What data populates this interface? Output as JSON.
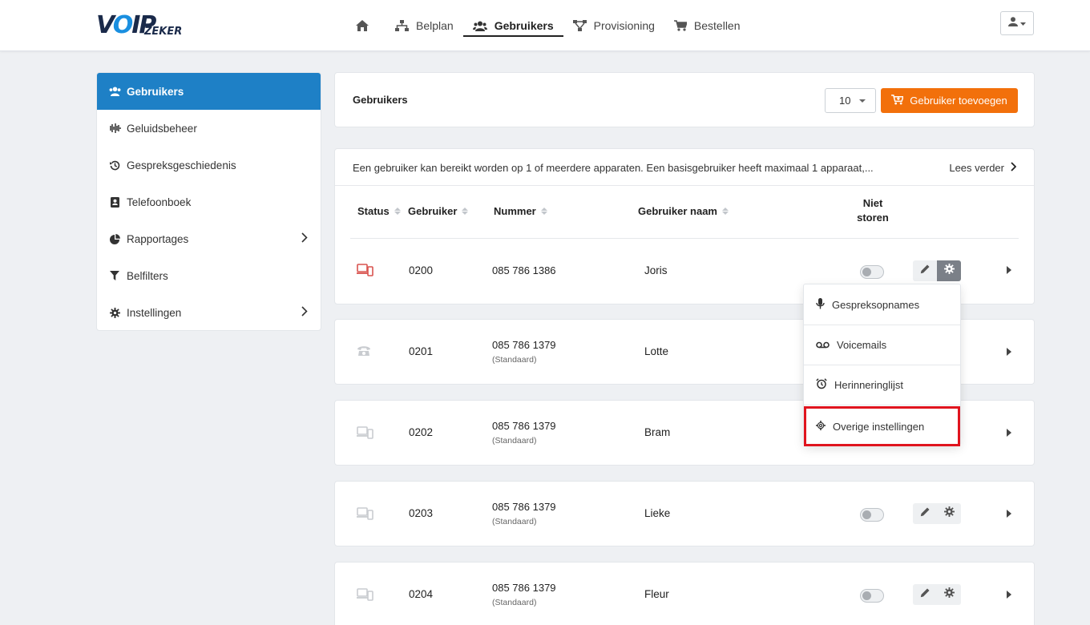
{
  "brand": {
    "logo_text": "VOIPZEKER"
  },
  "nav": {
    "home_icon": "home-icon",
    "items": [
      {
        "label": "Belplan",
        "icon": "sitemap-icon"
      },
      {
        "label": "Gebruikers",
        "icon": "users-icon",
        "active": true
      },
      {
        "label": "Provisioning",
        "icon": "network-icon"
      },
      {
        "label": "Bestellen",
        "icon": "cart-icon"
      }
    ],
    "user_menu_icon": "user-icon"
  },
  "sidebar": {
    "items": [
      {
        "label": "Gebruikers",
        "icon": "users-icon",
        "active": true
      },
      {
        "label": "Geluidsbeheer",
        "icon": "waveform-icon"
      },
      {
        "label": "Gespreksgeschiedenis",
        "icon": "history-icon"
      },
      {
        "label": "Telefoonboek",
        "icon": "address-book-icon"
      },
      {
        "label": "Rapportages",
        "icon": "pie-chart-icon",
        "has_submenu": true
      },
      {
        "label": "Belfilters",
        "icon": "filter-icon"
      },
      {
        "label": "Instellingen",
        "icon": "gear-icon",
        "has_submenu": true
      }
    ]
  },
  "header": {
    "title": "Gebruikers",
    "page_size": "10",
    "add_button": "Gebruiker toevoegen"
  },
  "info": {
    "text": "Een gebruiker kan bereikt worden op 1 of meerdere apparaten. Een basisgebruiker heeft maximaal 1 apparaat,...",
    "read_more": "Lees verder"
  },
  "table": {
    "columns": {
      "status": "Status",
      "user": "Gebruiker",
      "number": "Nummer",
      "name": "Gebruiker naam",
      "dnd_line1": "Niet",
      "dnd_line2": "storen"
    },
    "rows": [
      {
        "ext": "0200",
        "number": "085 786 1386",
        "sub": "",
        "name": "Joris",
        "status": "devices-icon",
        "status_color": "#d9534f"
      },
      {
        "ext": "0201",
        "number": "085 786 1379",
        "sub": "(Standaard)",
        "name": "Lotte",
        "status": "phone-icon",
        "status_color": "#c9ccd0"
      },
      {
        "ext": "0202",
        "number": "085 786 1379",
        "sub": "(Standaard)",
        "name": "Bram",
        "status": "devices-icon",
        "status_color": "#c9ccd0"
      },
      {
        "ext": "0203",
        "number": "085 786 1379",
        "sub": "(Standaard)",
        "name": "Lieke",
        "status": "devices-icon",
        "status_color": "#c9ccd0"
      },
      {
        "ext": "0204",
        "number": "085 786 1379",
        "sub": "(Standaard)",
        "name": "Fleur",
        "status": "devices-icon",
        "status_color": "#c9ccd0"
      }
    ]
  },
  "settings_menu": {
    "items": [
      {
        "label": "Gespreksopnames",
        "icon": "microphone-icon"
      },
      {
        "label": "Voicemails",
        "icon": "voicemail-icon"
      },
      {
        "label": "Herinneringlijst",
        "icon": "alarm-clock-icon"
      },
      {
        "label": "Overige instellingen",
        "icon": "gear-icon",
        "highlighted": true
      }
    ]
  },
  "colors": {
    "primary": "#1e80c6",
    "accent": "#f2700b",
    "highlight": "#e0141e"
  }
}
